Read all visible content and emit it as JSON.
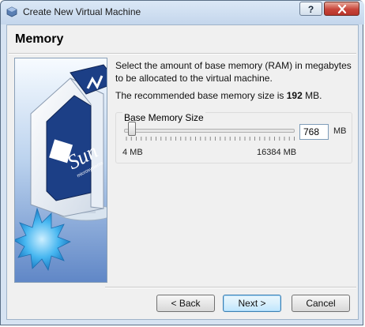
{
  "window": {
    "title": "Create New Virtual Machine",
    "help_label": "?"
  },
  "page": {
    "heading": "Memory",
    "description": "Select the amount of base memory (RAM) in megabytes to be allocated to the virtual machine.",
    "recommended_prefix": "The recommended base memory size is ",
    "recommended_value": "192",
    "recommended_suffix": " MB."
  },
  "memory": {
    "group_label": "Base Memory Size",
    "value": "768",
    "unit": "MB",
    "min_label": "4 MB",
    "max_label": "16384 MB",
    "slider_fraction": 0.0466
  },
  "art": {
    "logo_text": "Sun",
    "logo_subtext": "microsystems"
  },
  "buttons": {
    "back": "< Back",
    "next": "Next >",
    "cancel": "Cancel"
  },
  "colors": {
    "titlebar": "#c4d6ec",
    "close_button": "#c8453a",
    "primary_button_border": "#3c7fb1"
  }
}
